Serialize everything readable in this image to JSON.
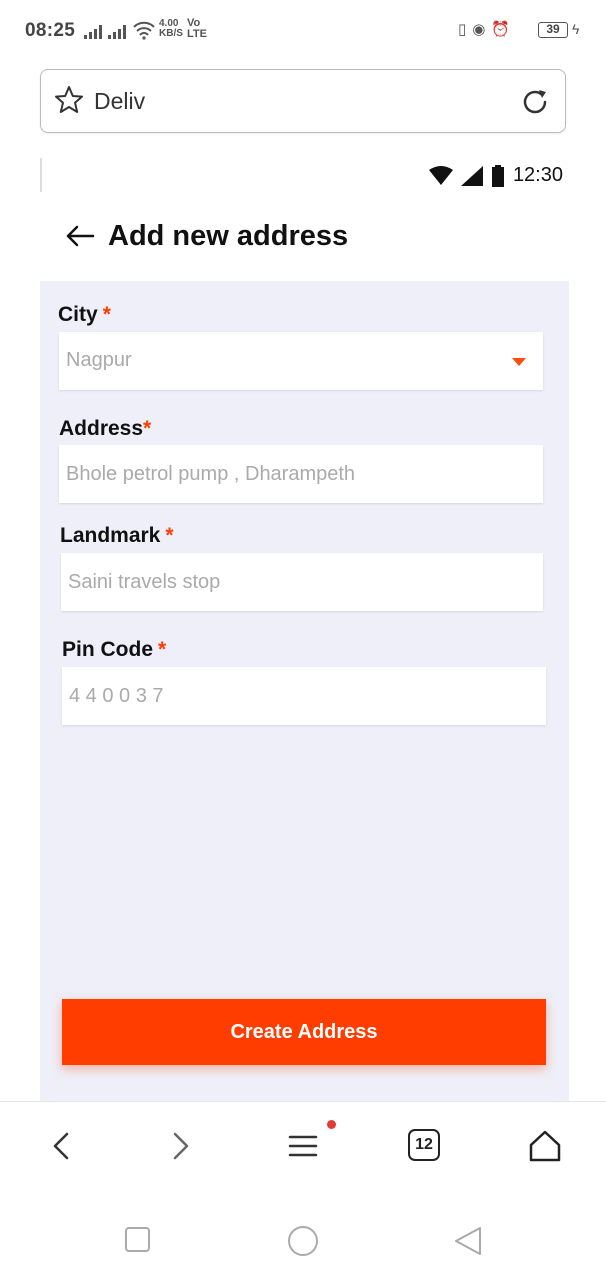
{
  "status_bar": {
    "time": "08:25",
    "net_speed_value": "4.00",
    "net_speed_unit": "KB/S",
    "volte_top": "Vo",
    "volte_bottom": "LTE",
    "battery_level": "39"
  },
  "browser": {
    "url_text": "Deliv",
    "tab_count": "12"
  },
  "page": {
    "inner_status_time": "12:30",
    "title": "Add new address",
    "city": {
      "label": "City",
      "required_mark": "*",
      "value": "Nagpur"
    },
    "address": {
      "label": "Address",
      "required_mark": "*",
      "placeholder": "Bhole petrol pump , Dharampeth"
    },
    "landmark": {
      "label": "Landmark",
      "required_mark": "*",
      "placeholder": "Saini travels stop"
    },
    "pincode": {
      "label": "Pin Code",
      "required_mark": "*",
      "placeholder": "4 4 0 0 3 7"
    },
    "submit_label": "Create Address"
  },
  "colors": {
    "accent": "#ff3d00",
    "page_background": "#eeeff8"
  }
}
